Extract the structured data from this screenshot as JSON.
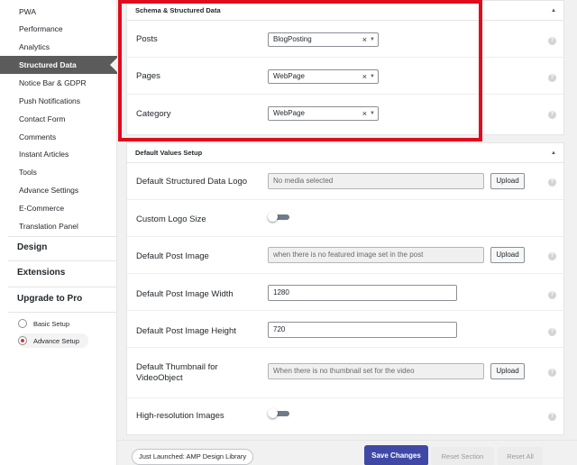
{
  "sidebar": {
    "items": [
      {
        "label": "PWA"
      },
      {
        "label": "Performance"
      },
      {
        "label": "Analytics"
      },
      {
        "label": "Structured Data"
      },
      {
        "label": "Notice Bar & GDPR"
      },
      {
        "label": "Push Notifications"
      },
      {
        "label": "Contact Form"
      },
      {
        "label": "Comments"
      },
      {
        "label": "Instant Articles"
      },
      {
        "label": "Tools"
      },
      {
        "label": "Advance Settings"
      },
      {
        "label": "E-Commerce"
      },
      {
        "label": "Translation Panel"
      }
    ],
    "active_item": "Structured Data",
    "sections": [
      {
        "label": "Design"
      },
      {
        "label": "Extensions"
      },
      {
        "label": "Upgrade to Pro"
      }
    ],
    "setup_modes": [
      {
        "label": "Basic Setup",
        "checked": false
      },
      {
        "label": "Advance Setup",
        "checked": true
      }
    ]
  },
  "schema_panel": {
    "title": "Schema & Structured Data",
    "rows": [
      {
        "label": "Posts",
        "value": "BlogPosting"
      },
      {
        "label": "Pages",
        "value": "WebPage"
      },
      {
        "label": "Category",
        "value": "WebPage"
      }
    ]
  },
  "defaults_panel": {
    "title": "Default Values Setup",
    "logo": {
      "label": "Default Structured Data Logo",
      "placeholder": "No media selected",
      "button": "Upload"
    },
    "custom_logo_size": {
      "label": "Custom Logo Size",
      "enabled": false
    },
    "post_image": {
      "label": "Default Post Image",
      "placeholder": "when there is no featured image set in the post",
      "button": "Upload"
    },
    "image_width": {
      "label": "Default Post Image Width",
      "value": "1280"
    },
    "image_height": {
      "label": "Default Post Image Height",
      "value": "720"
    },
    "thumbnail": {
      "label_line1": "Default Thumbnail for",
      "label_line2": "VideoObject",
      "placeholder": "When there is no thumbnail set for the video",
      "button": "Upload"
    },
    "high_res": {
      "label": "High-resolution Images",
      "enabled": false
    }
  },
  "icons": {
    "clear": "×",
    "dropdown_arrow": "▼",
    "collapse": "▲",
    "help": "?"
  },
  "colors": {
    "highlight": "#e00b1c",
    "primary_button": "#3f48a5",
    "active_nav": "#5b5b5b",
    "radio_checked": "#d63638"
  },
  "footer": {
    "announcement": "Just Launched: AMP Design Library",
    "save": "Save Changes",
    "reset_section": "Reset Section",
    "reset_all": "Reset All"
  }
}
